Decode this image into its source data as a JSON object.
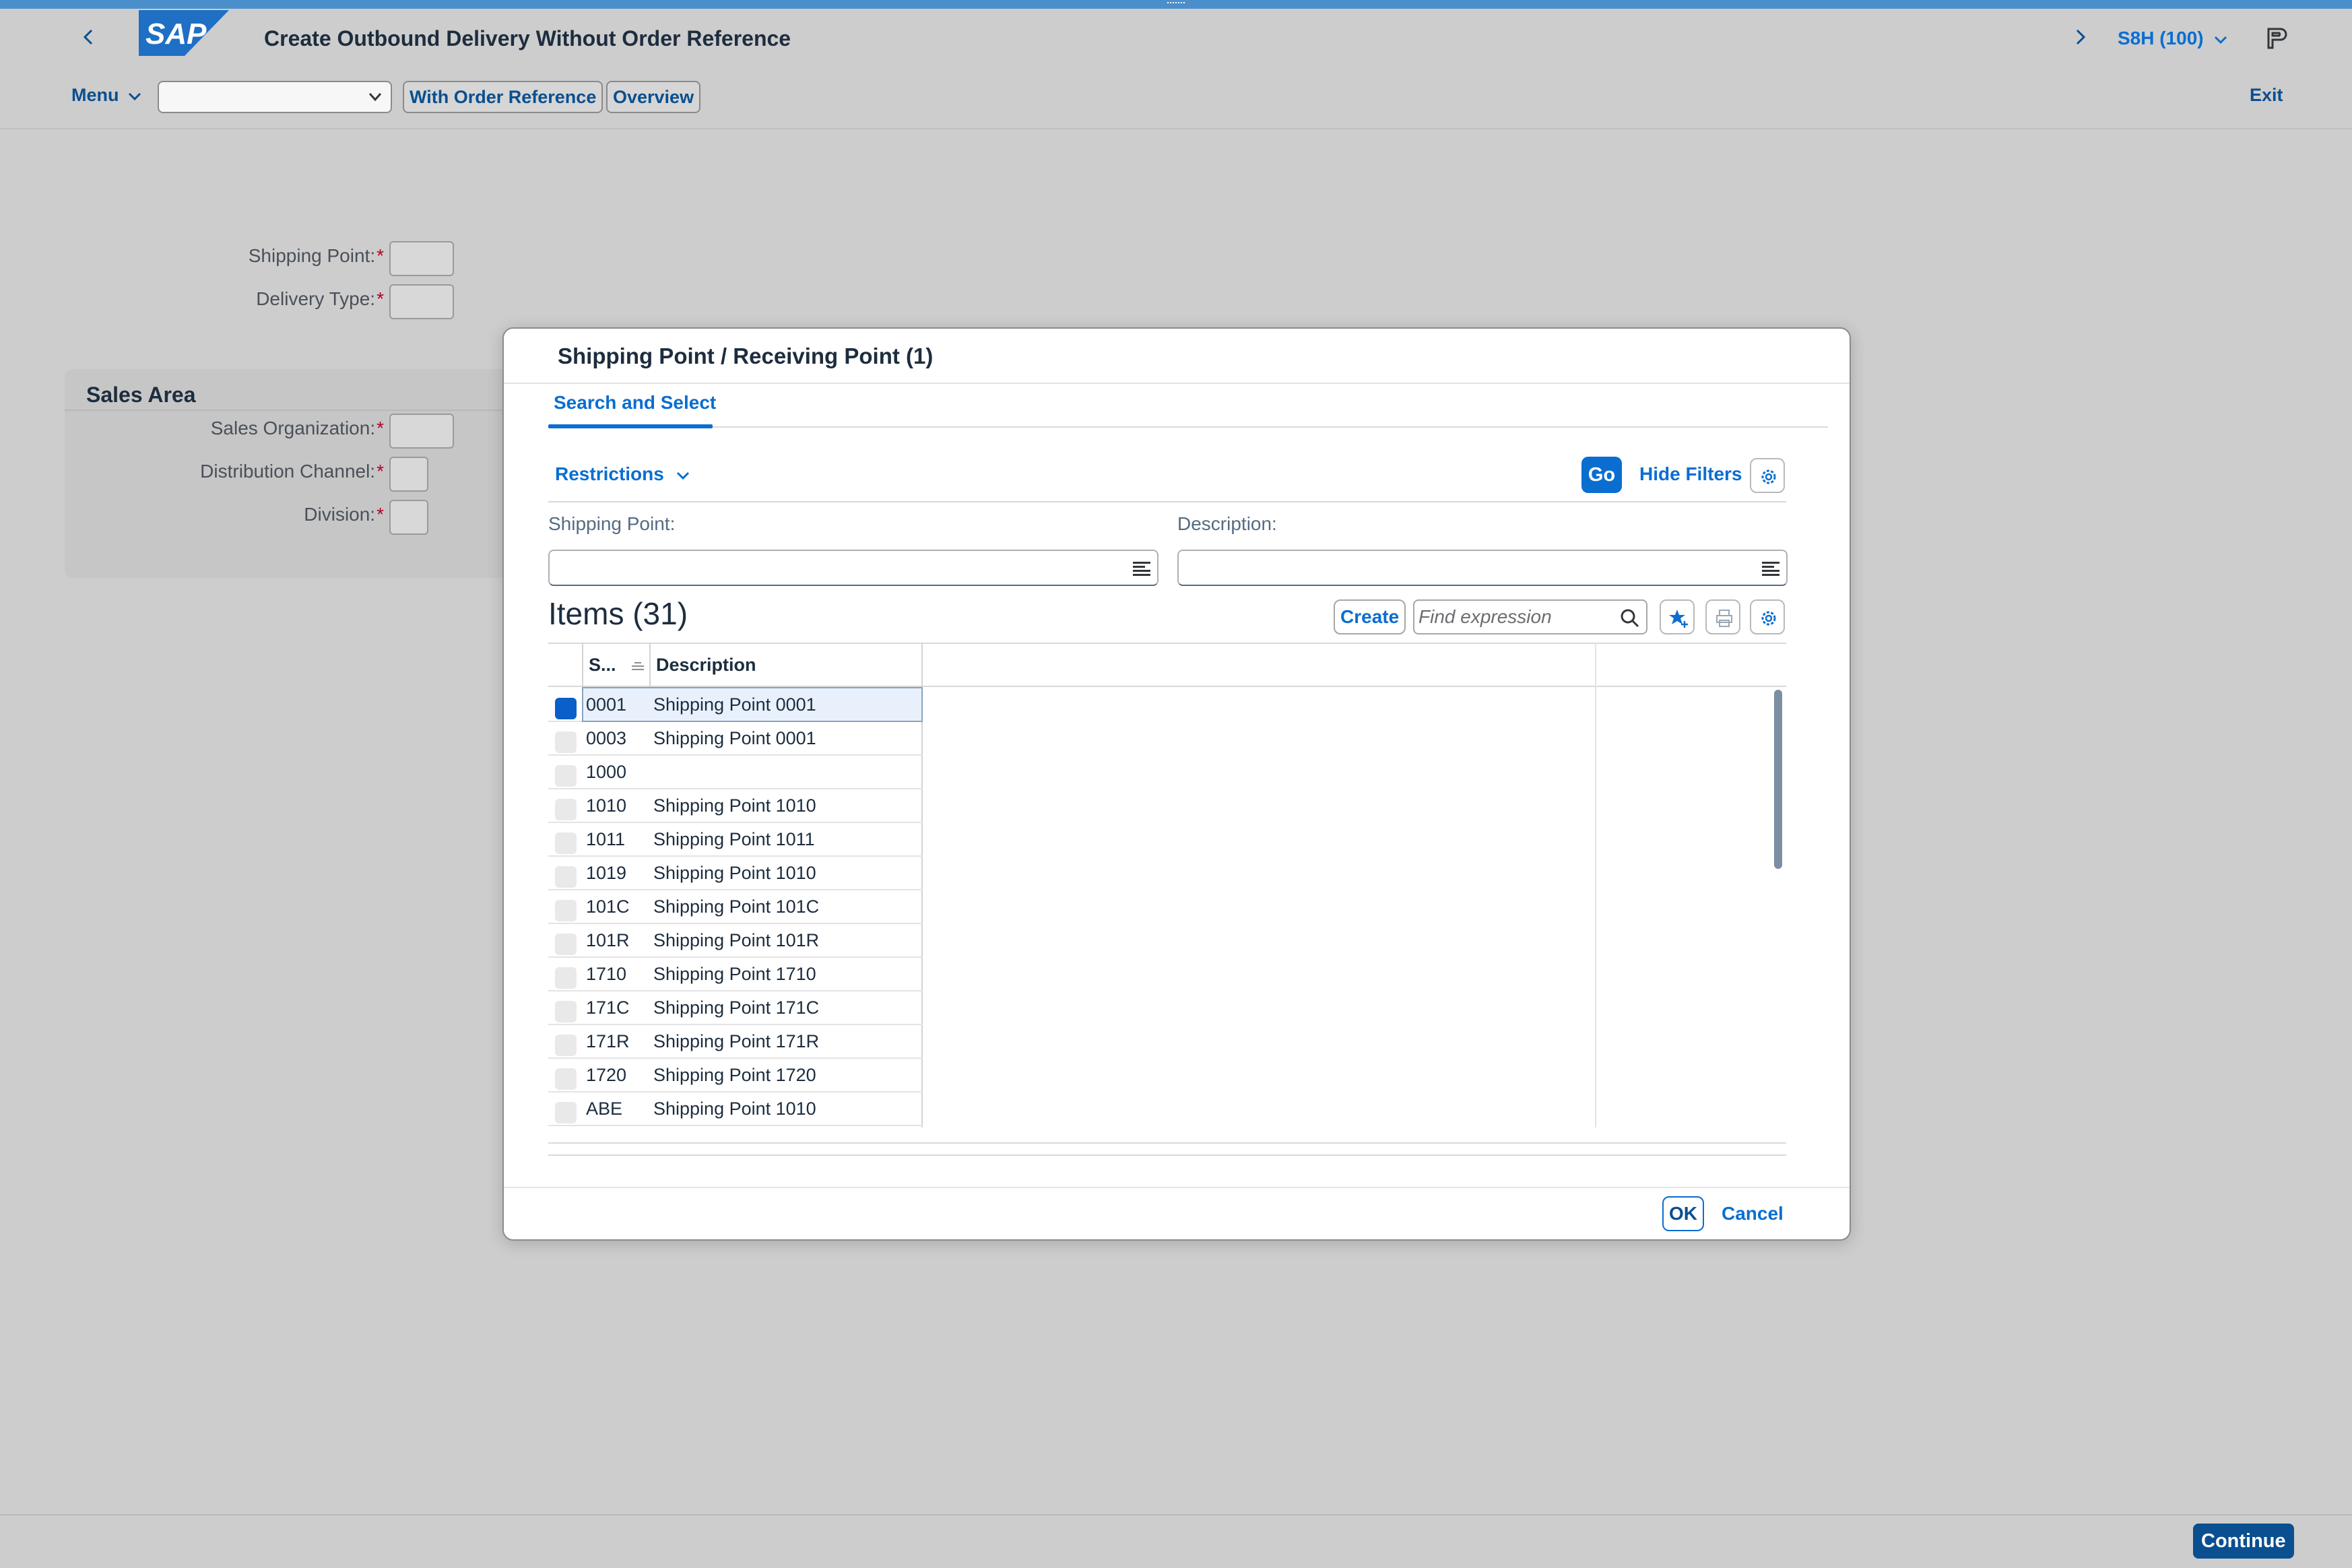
{
  "shell": {
    "title": "Create Outbound Delivery Without Order Reference",
    "logo": "SAP",
    "system": "S8H (100)",
    "icons": [
      "back-icon",
      "forward-icon",
      "chevron-down-icon",
      "profile-icon"
    ]
  },
  "toolbar": {
    "menu_label": "Menu",
    "select_value": "",
    "with_order_ref_label": "With Order Reference",
    "overview_label": "Overview",
    "exit_label": "Exit"
  },
  "form": {
    "shipping_point_label": "Shipping Point:",
    "delivery_type_label": "Delivery Type:",
    "required_marker": "*",
    "sales_area_title": "Sales Area",
    "sales_org_label": "Sales Organization:",
    "distribution_channel_label": "Distribution Channel:",
    "division_label": "Division:"
  },
  "footer": {
    "continue_label": "Continue"
  },
  "dialog": {
    "title": "Shipping Point / Receiving Point (1)",
    "tab_label": "Search and Select",
    "restrictions_label": "Restrictions",
    "go_label": "Go",
    "hide_filters_label": "Hide Filters",
    "filter_shipping_point_label": "Shipping Point:",
    "filter_description_label": "Description:",
    "filter_shipping_point_value": "",
    "filter_description_value": "",
    "items_title": "Items (31)",
    "create_label": "Create",
    "find_placeholder": "Find expression",
    "columns": [
      "S...",
      "Description"
    ],
    "rows": [
      {
        "code": "0001",
        "desc": "Shipping Point 0001",
        "selected": true
      },
      {
        "code": "0003",
        "desc": "Shipping Point 0001",
        "selected": false
      },
      {
        "code": "1000",
        "desc": "",
        "selected": false
      },
      {
        "code": "1010",
        "desc": "Shipping Point 1010",
        "selected": false
      },
      {
        "code": "1011",
        "desc": "Shipping Point 1011",
        "selected": false
      },
      {
        "code": "1019",
        "desc": "Shipping Point 1010",
        "selected": false
      },
      {
        "code": "101C",
        "desc": "Shipping Point 101C",
        "selected": false
      },
      {
        "code": "101R",
        "desc": "Shipping Point 101R",
        "selected": false
      },
      {
        "code": "1710",
        "desc": "Shipping Point 1710",
        "selected": false
      },
      {
        "code": "171C",
        "desc": "Shipping Point 171C",
        "selected": false
      },
      {
        "code": "171R",
        "desc": "Shipping Point 171R",
        "selected": false
      },
      {
        "code": "1720",
        "desc": "Shipping Point 1720",
        "selected": false
      },
      {
        "code": "ABE",
        "desc": "Shipping Point 1010",
        "selected": false
      }
    ],
    "ok_label": "OK",
    "cancel_label": "Cancel"
  },
  "colors": {
    "accent": "#0a6ed1",
    "topbar": "#4a8fcb",
    "required": "#b3002a",
    "background": "#cdcdcd"
  }
}
